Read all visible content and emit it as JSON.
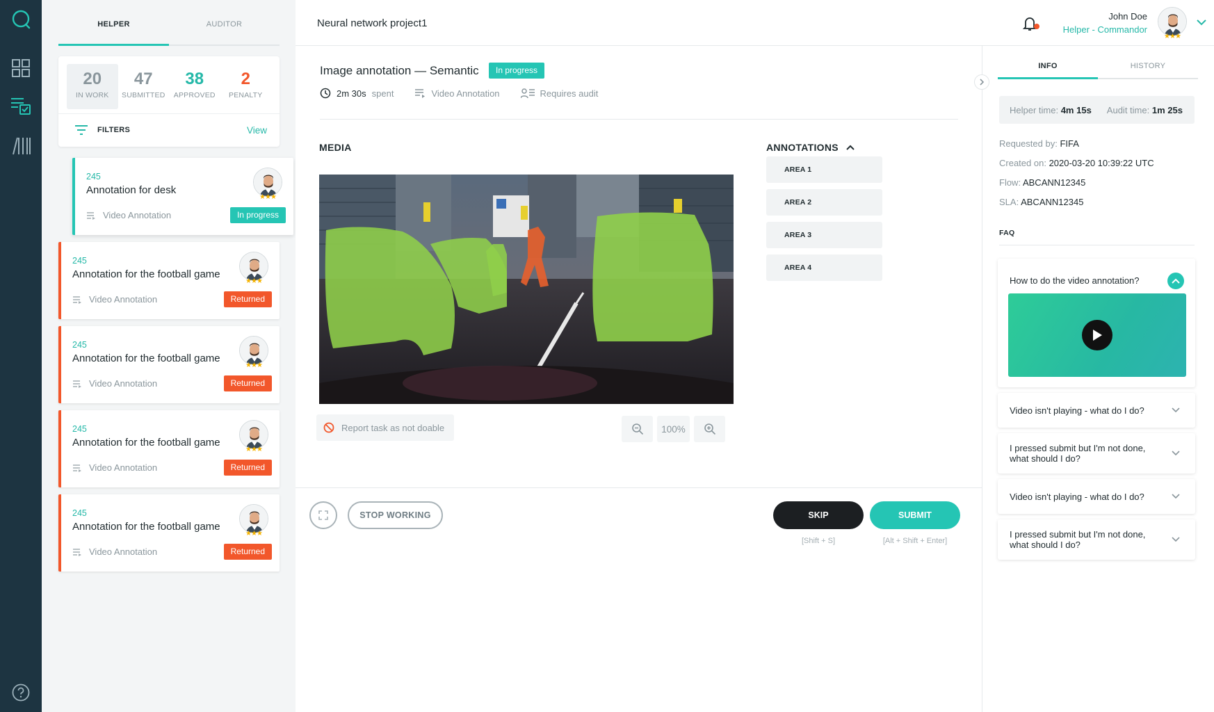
{
  "rail": {
    "icons": [
      "chat-icon",
      "dashboard-icon",
      "tasks-icon",
      "library-icon",
      "help-icon"
    ]
  },
  "tasks_panel": {
    "tabs": [
      "HELPER",
      "AUDITOR"
    ],
    "active_tab": "HELPER",
    "stats": [
      {
        "value": "20",
        "label": "IN WORK",
        "color": "#8a969c"
      },
      {
        "value": "47",
        "label": "SUBMITTED",
        "color": "#8a969c"
      },
      {
        "value": "38",
        "label": "APPROVED",
        "color": "#25b8a8"
      },
      {
        "value": "2",
        "label": "PENALTY",
        "color": "#f2572b"
      }
    ],
    "filters_label": "FILTERS",
    "filters_view": "View",
    "cards": [
      {
        "id": "245",
        "title": "Annotation for desk",
        "type": "Video Annotation",
        "status": "In progress"
      },
      {
        "id": "245",
        "title": "Annotation for the football game",
        "type": "Video Annotation",
        "status": "Returned"
      },
      {
        "id": "245",
        "title": "Annotation for the football game",
        "type": "Video Annotation",
        "status": "Returned"
      },
      {
        "id": "245",
        "title": "Annotation for the football game",
        "type": "Video Annotation",
        "status": "Returned"
      },
      {
        "id": "245",
        "title": "Annotation for the football game",
        "type": "Video Annotation",
        "status": "Returned"
      }
    ]
  },
  "header": {
    "project": "Neural network project1",
    "user_name": "John Doe",
    "user_role": "Helper - Commandor"
  },
  "main": {
    "title": "Image annotation — Semantic",
    "status": "In progress",
    "time_value": "2m 30s",
    "time_suffix": "spent",
    "task_type": "Video Annotation",
    "audit": "Requires audit",
    "media_label": "MEDIA",
    "annotations_label": "ANNOTATIONS",
    "areas": [
      "AREA 1",
      "AREA 2",
      "AREA 3",
      "AREA 4"
    ],
    "report_label": "Report task as not doable",
    "zoom": "100%",
    "stop_label": "STOP WORKING",
    "skip_label": "SKIP",
    "skip_hint": "[Shift + S]",
    "submit_label": "SUBMIT",
    "submit_hint": "[Alt + Shift + Enter]"
  },
  "info_panel": {
    "tabs": [
      "INFO",
      "HISTORY"
    ],
    "helper_time_label": "Helper time:",
    "helper_time": "4m 15s",
    "audit_time_label": "Audit time:",
    "audit_time": "1m 25s",
    "details": [
      {
        "label": "Requested by:",
        "value": "FIFA"
      },
      {
        "label": "Created on:",
        "value": "2020-03-20 10:39:22 UTC"
      },
      {
        "label": "Flow:",
        "value": "ABCANN12345"
      },
      {
        "label": "SLA:",
        "value": "ABCANN12345"
      }
    ],
    "faq_label": "FAQ",
    "faqs": [
      {
        "q": "How to do the video annotation?",
        "expanded": true
      },
      {
        "q": "Video isn't playing - what do I do?",
        "expanded": false
      },
      {
        "q": "I pressed submit but I'm not done, what should I do?",
        "expanded": false
      },
      {
        "q": "Video isn't playing - what do I do?",
        "expanded": false
      },
      {
        "q": "I pressed submit but I'm not done, what should I do?",
        "expanded": false
      }
    ]
  },
  "colors": {
    "accent": "#25c5b4",
    "returned": "#f2572b",
    "rail": "#1d3441"
  }
}
